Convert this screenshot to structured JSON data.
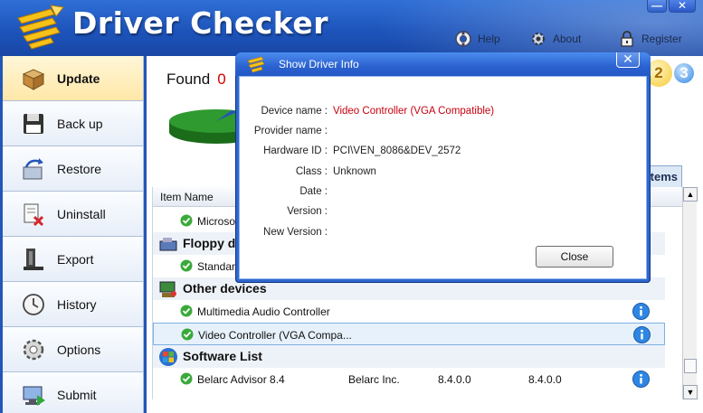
{
  "app": {
    "title": "Driver Checker",
    "help_label": "Help",
    "about_label": "About",
    "register_label": "Register",
    "minimize_label": "—",
    "close_label": "✕"
  },
  "sidebar": {
    "items": [
      {
        "label": "Update",
        "icon": "box-icon",
        "active": true
      },
      {
        "label": "Back up",
        "icon": "floppy-icon",
        "active": false
      },
      {
        "label": "Restore",
        "icon": "restore-icon",
        "active": false
      },
      {
        "label": "Uninstall",
        "icon": "uninstall-icon",
        "active": false
      },
      {
        "label": "Export",
        "icon": "export-icon",
        "active": false
      },
      {
        "label": "History",
        "icon": "clock-icon",
        "active": false
      },
      {
        "label": "Options",
        "icon": "gear-icon",
        "active": false
      },
      {
        "label": "Submit",
        "icon": "submit-icon",
        "active": false
      }
    ]
  },
  "main": {
    "found_label": "Found",
    "found_count": "0",
    "step_two": "2",
    "step_three": "3",
    "items_tab_label": "tems",
    "grid_header": "Item Name",
    "rows": [
      {
        "kind": "item",
        "name": "Microsoft"
      },
      {
        "kind": "group",
        "name": "Floppy d"
      },
      {
        "kind": "item",
        "name": "Standarc"
      },
      {
        "kind": "group",
        "name": "Other devices"
      },
      {
        "kind": "item",
        "name": "Multimedia Audio Controller"
      },
      {
        "kind": "item",
        "name": "Video Controller (VGA Compa...",
        "selected": true
      },
      {
        "kind": "group",
        "name": "Software List"
      },
      {
        "kind": "item",
        "name": "Belarc Advisor 8.4",
        "publisher": "Belarc Inc.",
        "version": "8.4.0.0",
        "new_version": "8.4.0.0"
      }
    ]
  },
  "dialog": {
    "title": "Show Driver Info",
    "close_x": "✕",
    "fields": [
      {
        "label": "Device name :",
        "value": "Video Controller (VGA Compatible)",
        "color": "#c8000f"
      },
      {
        "label": "Provider name :",
        "value": ""
      },
      {
        "label": "Hardware ID :",
        "value": "PCI\\VEN_8086&DEV_2572"
      },
      {
        "label": "Class :",
        "value": "Unknown"
      },
      {
        "label": "Date :",
        "value": ""
      },
      {
        "label": "Version :",
        "value": ""
      },
      {
        "label": "New Version :",
        "value": ""
      }
    ],
    "close_button": "Close"
  },
  "colors": {
    "header_blue": "#1d54bb",
    "accent_red": "#d40000",
    "ok_green": "#3aa93a",
    "info_blue": "#2f86e2"
  }
}
